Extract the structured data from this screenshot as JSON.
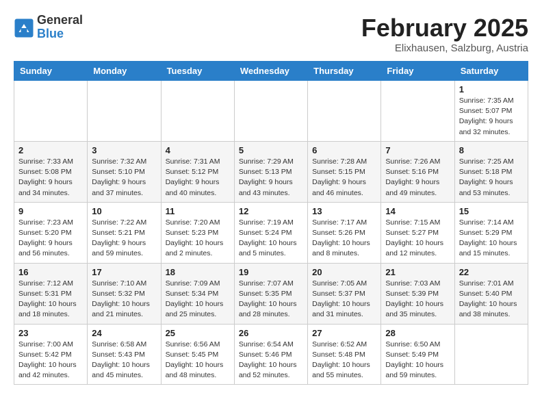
{
  "header": {
    "logo_general": "General",
    "logo_blue": "Blue",
    "title": "February 2025",
    "subtitle": "Elixhausen, Salzburg, Austria"
  },
  "weekdays": [
    "Sunday",
    "Monday",
    "Tuesday",
    "Wednesday",
    "Thursday",
    "Friday",
    "Saturday"
  ],
  "weeks": [
    [
      {
        "day": "",
        "info": ""
      },
      {
        "day": "",
        "info": ""
      },
      {
        "day": "",
        "info": ""
      },
      {
        "day": "",
        "info": ""
      },
      {
        "day": "",
        "info": ""
      },
      {
        "day": "",
        "info": ""
      },
      {
        "day": "1",
        "info": "Sunrise: 7:35 AM\nSunset: 5:07 PM\nDaylight: 9 hours and 32 minutes."
      }
    ],
    [
      {
        "day": "2",
        "info": "Sunrise: 7:33 AM\nSunset: 5:08 PM\nDaylight: 9 hours and 34 minutes."
      },
      {
        "day": "3",
        "info": "Sunrise: 7:32 AM\nSunset: 5:10 PM\nDaylight: 9 hours and 37 minutes."
      },
      {
        "day": "4",
        "info": "Sunrise: 7:31 AM\nSunset: 5:12 PM\nDaylight: 9 hours and 40 minutes."
      },
      {
        "day": "5",
        "info": "Sunrise: 7:29 AM\nSunset: 5:13 PM\nDaylight: 9 hours and 43 minutes."
      },
      {
        "day": "6",
        "info": "Sunrise: 7:28 AM\nSunset: 5:15 PM\nDaylight: 9 hours and 46 minutes."
      },
      {
        "day": "7",
        "info": "Sunrise: 7:26 AM\nSunset: 5:16 PM\nDaylight: 9 hours and 49 minutes."
      },
      {
        "day": "8",
        "info": "Sunrise: 7:25 AM\nSunset: 5:18 PM\nDaylight: 9 hours and 53 minutes."
      }
    ],
    [
      {
        "day": "9",
        "info": "Sunrise: 7:23 AM\nSunset: 5:20 PM\nDaylight: 9 hours and 56 minutes."
      },
      {
        "day": "10",
        "info": "Sunrise: 7:22 AM\nSunset: 5:21 PM\nDaylight: 9 hours and 59 minutes."
      },
      {
        "day": "11",
        "info": "Sunrise: 7:20 AM\nSunset: 5:23 PM\nDaylight: 10 hours and 2 minutes."
      },
      {
        "day": "12",
        "info": "Sunrise: 7:19 AM\nSunset: 5:24 PM\nDaylight: 10 hours and 5 minutes."
      },
      {
        "day": "13",
        "info": "Sunrise: 7:17 AM\nSunset: 5:26 PM\nDaylight: 10 hours and 8 minutes."
      },
      {
        "day": "14",
        "info": "Sunrise: 7:15 AM\nSunset: 5:27 PM\nDaylight: 10 hours and 12 minutes."
      },
      {
        "day": "15",
        "info": "Sunrise: 7:14 AM\nSunset: 5:29 PM\nDaylight: 10 hours and 15 minutes."
      }
    ],
    [
      {
        "day": "16",
        "info": "Sunrise: 7:12 AM\nSunset: 5:31 PM\nDaylight: 10 hours and 18 minutes."
      },
      {
        "day": "17",
        "info": "Sunrise: 7:10 AM\nSunset: 5:32 PM\nDaylight: 10 hours and 21 minutes."
      },
      {
        "day": "18",
        "info": "Sunrise: 7:09 AM\nSunset: 5:34 PM\nDaylight: 10 hours and 25 minutes."
      },
      {
        "day": "19",
        "info": "Sunrise: 7:07 AM\nSunset: 5:35 PM\nDaylight: 10 hours and 28 minutes."
      },
      {
        "day": "20",
        "info": "Sunrise: 7:05 AM\nSunset: 5:37 PM\nDaylight: 10 hours and 31 minutes."
      },
      {
        "day": "21",
        "info": "Sunrise: 7:03 AM\nSunset: 5:39 PM\nDaylight: 10 hours and 35 minutes."
      },
      {
        "day": "22",
        "info": "Sunrise: 7:01 AM\nSunset: 5:40 PM\nDaylight: 10 hours and 38 minutes."
      }
    ],
    [
      {
        "day": "23",
        "info": "Sunrise: 7:00 AM\nSunset: 5:42 PM\nDaylight: 10 hours and 42 minutes."
      },
      {
        "day": "24",
        "info": "Sunrise: 6:58 AM\nSunset: 5:43 PM\nDaylight: 10 hours and 45 minutes."
      },
      {
        "day": "25",
        "info": "Sunrise: 6:56 AM\nSunset: 5:45 PM\nDaylight: 10 hours and 48 minutes."
      },
      {
        "day": "26",
        "info": "Sunrise: 6:54 AM\nSunset: 5:46 PM\nDaylight: 10 hours and 52 minutes."
      },
      {
        "day": "27",
        "info": "Sunrise: 6:52 AM\nSunset: 5:48 PM\nDaylight: 10 hours and 55 minutes."
      },
      {
        "day": "28",
        "info": "Sunrise: 6:50 AM\nSunset: 5:49 PM\nDaylight: 10 hours and 59 minutes."
      },
      {
        "day": "",
        "info": ""
      }
    ]
  ]
}
